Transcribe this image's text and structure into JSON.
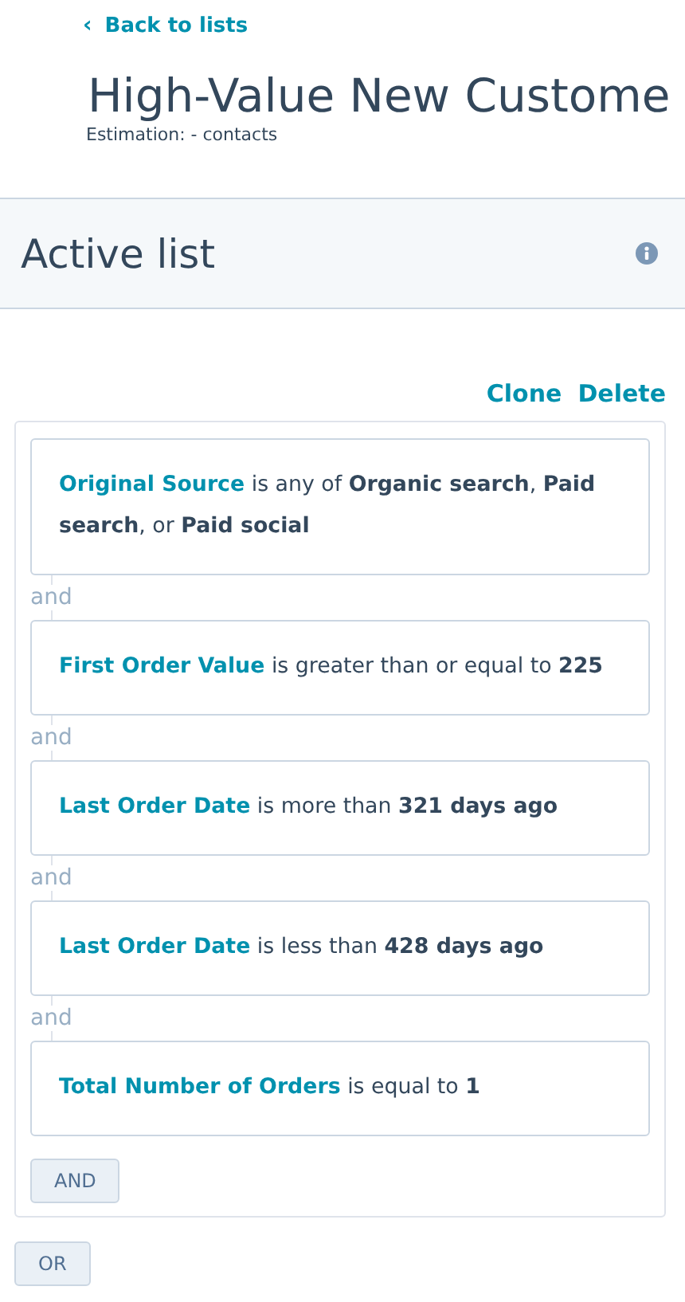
{
  "back_link": {
    "icon": "‹",
    "label": "Back to lists"
  },
  "title": "High-Value New Custome",
  "subtitle": "Estimation: - contacts",
  "section": {
    "title": "Active list"
  },
  "actions": [
    "Clone",
    "Delete"
  ],
  "filters": [
    {
      "field": "Original Source",
      "condition": "is any of **Organic search**, **Paid search**, or **Paid social**"
    },
    {
      "joiner": "and",
      "field": "First Order Value",
      "condition": "is greater than or equal to **225**"
    },
    {
      "joiner": "and",
      "field": "Last Order Date",
      "condition": "is more than **321 days ago**"
    },
    {
      "joiner": "and",
      "field": "Last Order Date",
      "condition": "is less than **428 days ago**"
    },
    {
      "joiner": "and",
      "field": "Total Number of Orders",
      "condition": "is equal to **1**"
    }
  ],
  "and_button": "AND",
  "or_button": "OR"
}
